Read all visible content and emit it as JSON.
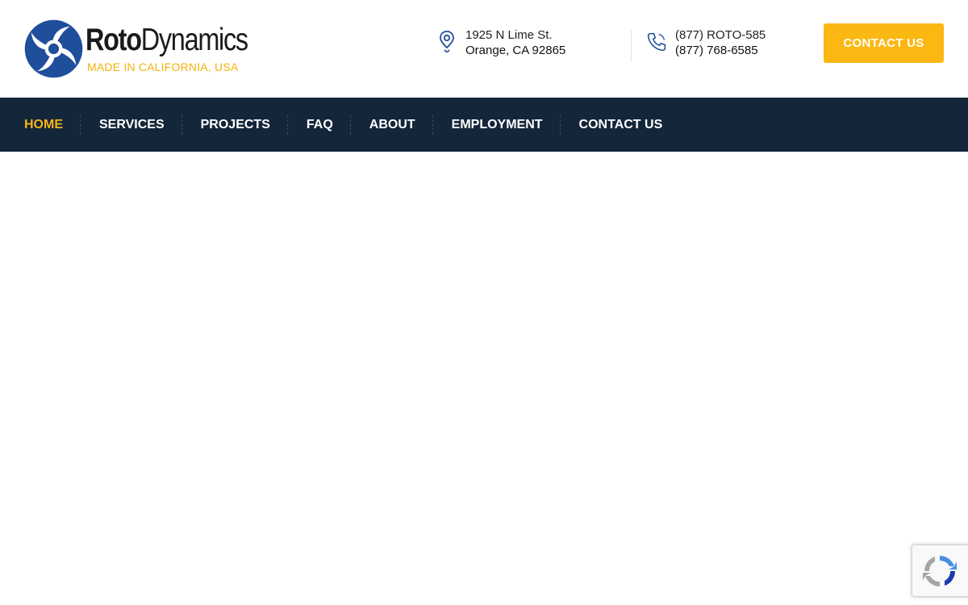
{
  "header": {
    "logo": {
      "wordmark_bold": "Roto",
      "wordmark_light": "Dynamics",
      "tagline": "MADE IN CALIFORNIA, USA",
      "icon": "swirl-logo-icon",
      "colors": {
        "primary": "#1f4e9b",
        "accent": "#f4b20c",
        "text": "#1a1a1a"
      }
    },
    "address": {
      "icon": "map-pin-icon",
      "line1": "1925 N Lime St.",
      "line2": "Orange, CA 92865"
    },
    "phone": {
      "icon": "phone-icon",
      "line1": "(877) ROTO-585",
      "line2": "(877) 768-6585"
    },
    "cta": {
      "label": "CONTACT US",
      "color": "#fbb813"
    }
  },
  "nav": {
    "background": "#13263a",
    "active_color": "#f6b31c",
    "items": [
      {
        "label": "HOME",
        "active": true
      },
      {
        "label": "SERVICES",
        "active": false
      },
      {
        "label": "PROJECTS",
        "active": false
      },
      {
        "label": "FAQ",
        "active": false
      },
      {
        "label": "ABOUT",
        "active": false
      },
      {
        "label": "EMPLOYMENT",
        "active": false
      },
      {
        "label": "CONTACT US",
        "active": false
      }
    ]
  },
  "recaptcha": {
    "icon": "recaptcha-icon"
  }
}
